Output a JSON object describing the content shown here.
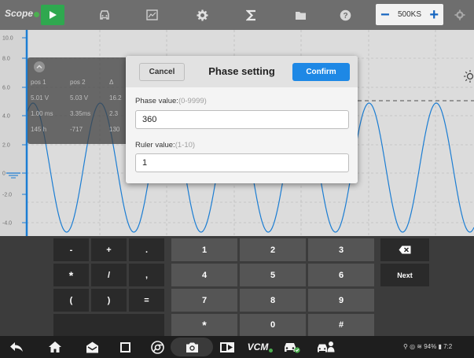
{
  "toolbar": {
    "logo": "Scope",
    "timebase": "500KS",
    "icons": [
      "play-icon",
      "car-icon",
      "chart-icon",
      "gear-icon",
      "sigma-icon",
      "folder-icon",
      "help-icon",
      "minus-icon",
      "plus-icon",
      "settings-icon"
    ]
  },
  "scope": {
    "y_ticks": [
      "10.0",
      "8.0",
      "6.0",
      "4.0",
      "2.0",
      "0",
      "-2.0",
      "-4.0"
    ],
    "info_panel": {
      "row1": [
        "pos 1",
        "pos 2",
        "Δ"
      ],
      "row2": [
        "5.01 V",
        "5.03 V",
        "16.2"
      ],
      "row3": [
        "1.00 ms",
        "3.35ms",
        "2.3"
      ],
      "row4": [
        "145 h",
        "-717",
        "130"
      ]
    }
  },
  "dialog": {
    "cancel_label": "Cancel",
    "title": "Phase setting",
    "confirm_label": "Confirm",
    "phase_label": "Phase value:",
    "phase_hint": "(0-9999)",
    "phase_value": "360",
    "ruler_label": "Ruler value:",
    "ruler_hint": "(1-10)",
    "ruler_value": "1"
  },
  "keyboard": {
    "row1": [
      "-",
      "+",
      ".",
      "1",
      "2",
      "3"
    ],
    "row2": [
      "*",
      "/",
      ",",
      "4",
      "5",
      "6"
    ],
    "row3": [
      "(",
      ")",
      "=",
      "7",
      "8",
      "9"
    ],
    "row4": [
      "*",
      "0",
      "#"
    ],
    "next_label": "Next",
    "icons": [
      "backspace-icon"
    ]
  },
  "navbar": {
    "icons": [
      "back-icon",
      "home-icon",
      "envelope-icon",
      "window-icon",
      "chrome-icon",
      "camera-icon",
      "screen-record-icon",
      "vcm-icon",
      "car-check-icon",
      "car-user-icon"
    ],
    "vcm_label": "VCM",
    "status": "⚲ ◎ ≋ 94% ▮ 7:2"
  }
}
